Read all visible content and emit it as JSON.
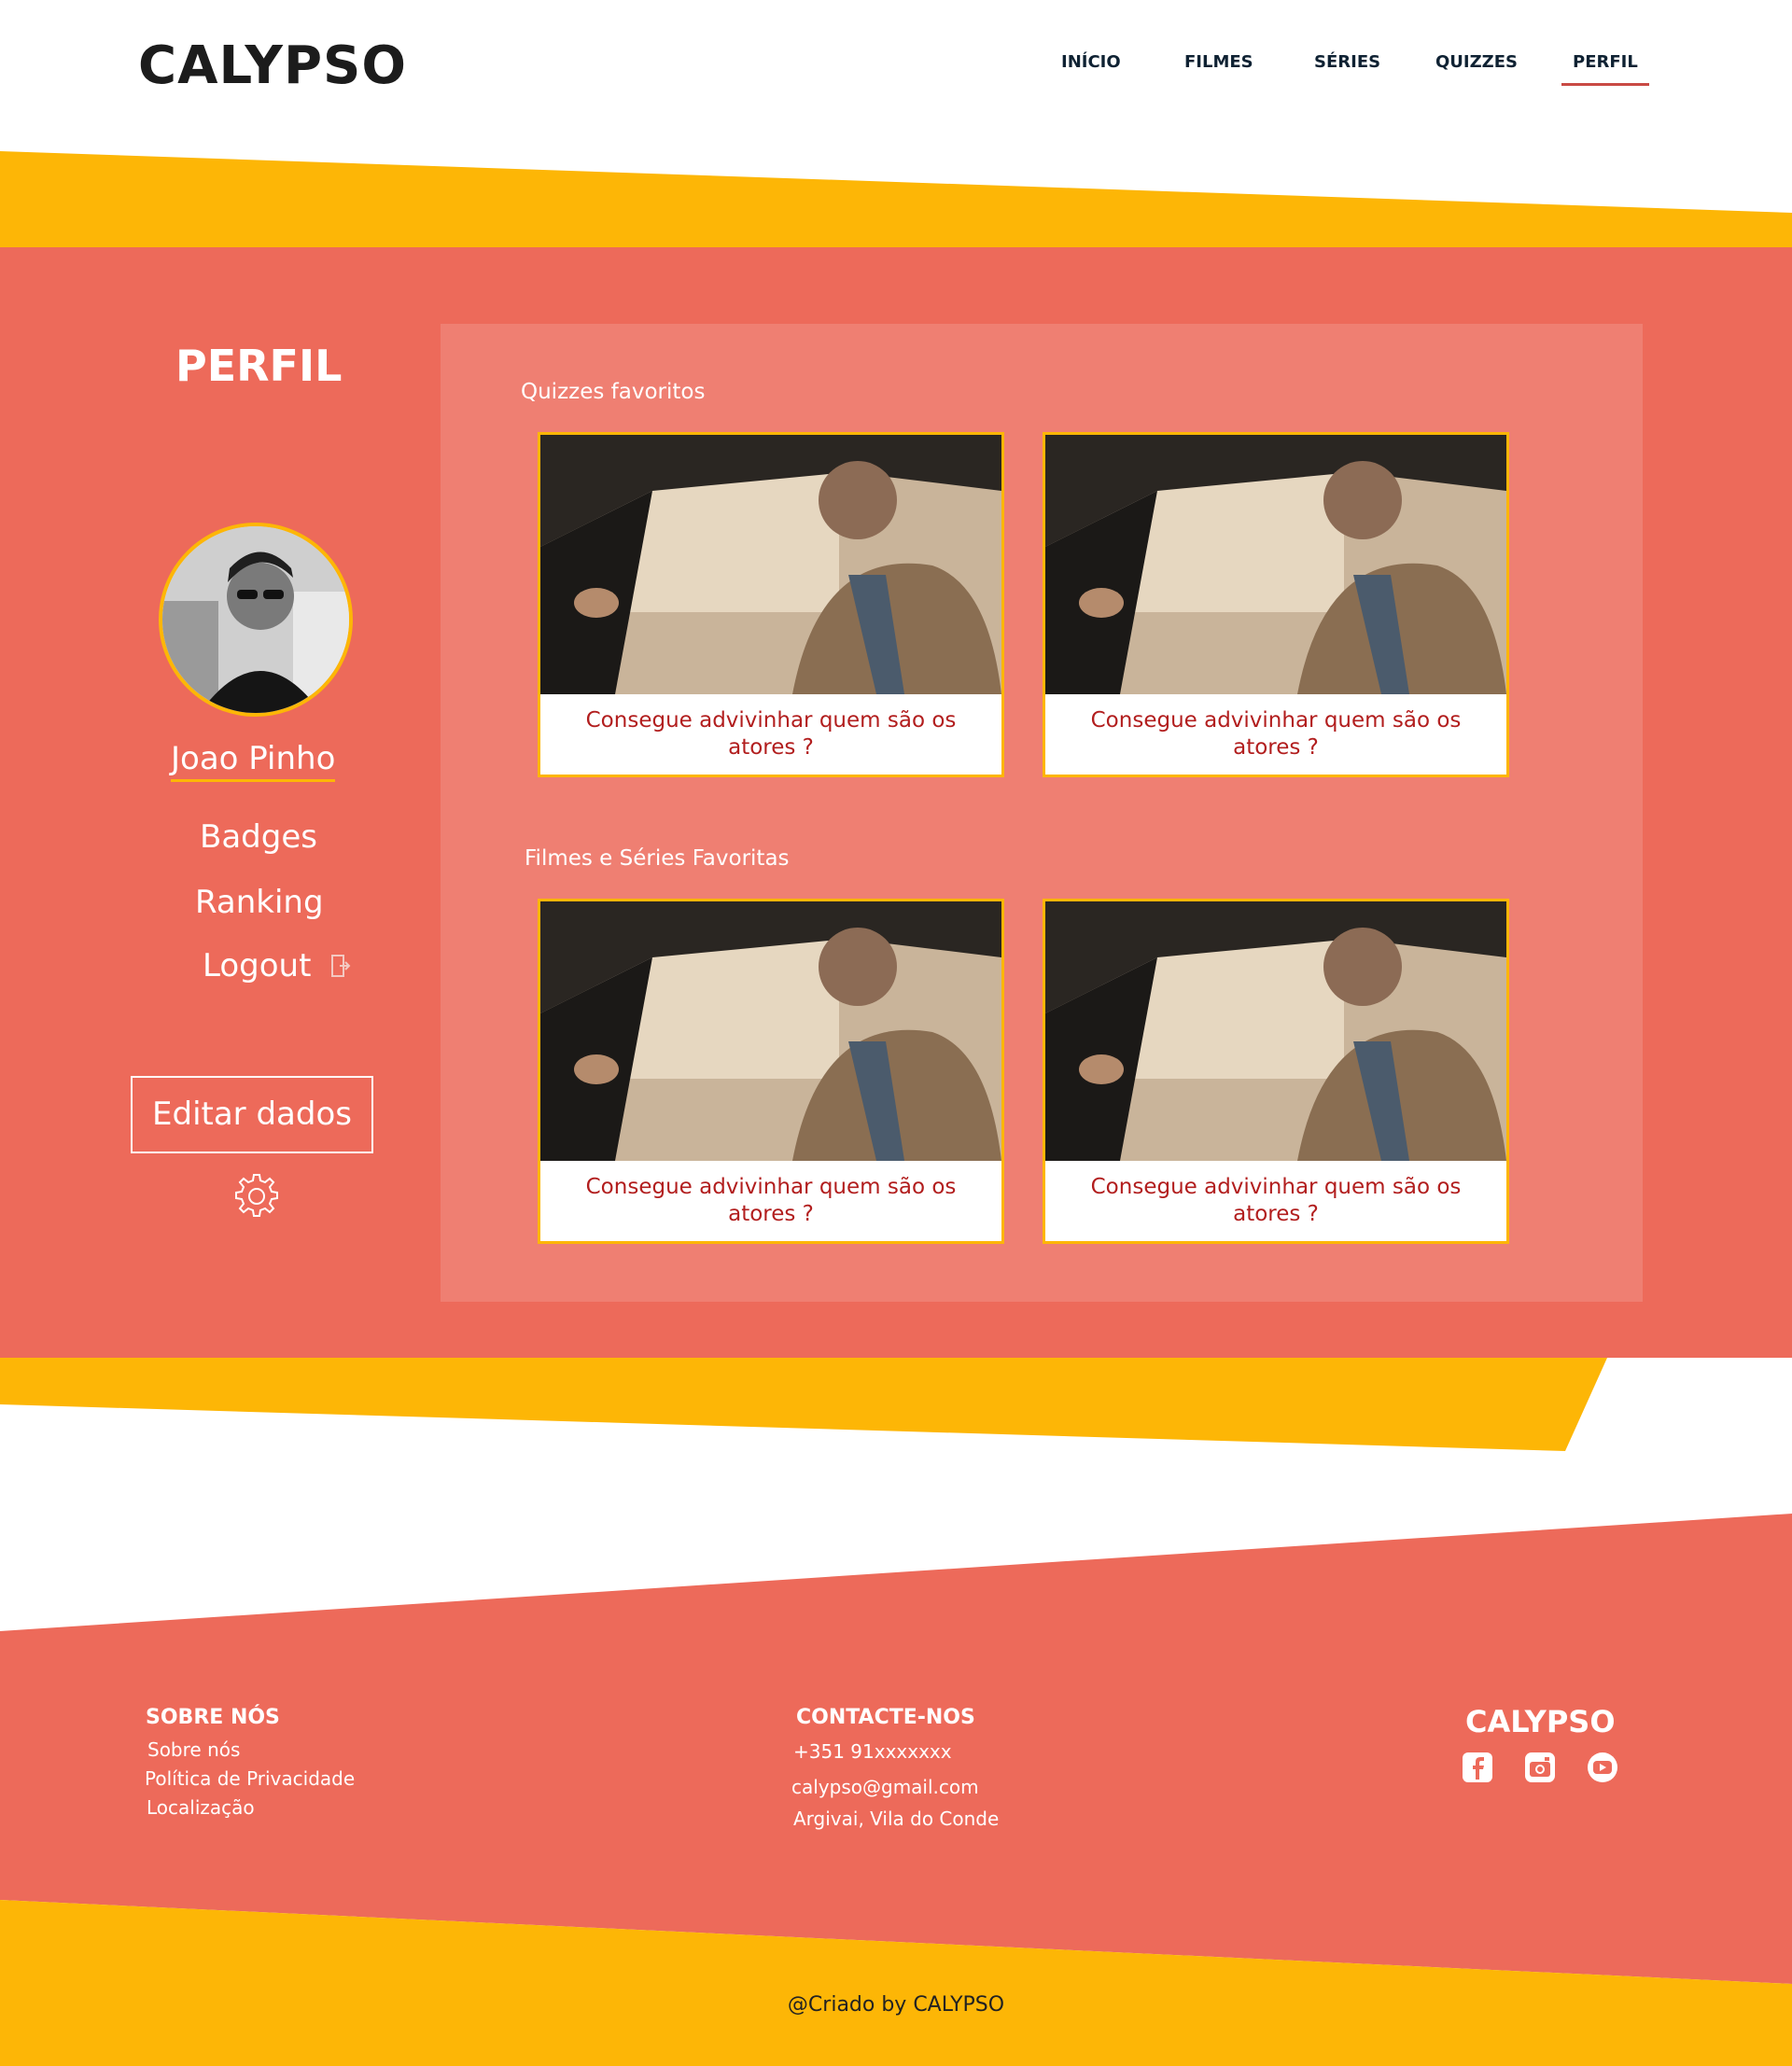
{
  "header": {
    "logo": "CALYPSO",
    "nav": [
      {
        "label": "INÍCIO"
      },
      {
        "label": "FILMES"
      },
      {
        "label": "SÉRIES"
      },
      {
        "label": "QUIZZES"
      },
      {
        "label": "PERFIL",
        "active": true
      }
    ]
  },
  "profile": {
    "title": "PERFIL",
    "username": "Joao Pinho",
    "menu": [
      "Badges",
      "Ranking",
      "Logout"
    ],
    "edit_button": "Editar dados"
  },
  "favorites": {
    "quizzes_label": "Quizzes favoritos",
    "media_label": "Filmes e Séries Favoritas",
    "quizzes": [
      {
        "caption": "Consegue advivinhar quem são os atores ?"
      },
      {
        "caption": "Consegue advivinhar quem são os atores ?"
      }
    ],
    "media": [
      {
        "caption": "Consegue advivinhar quem são os atores ?"
      },
      {
        "caption": "Consegue advivinhar quem são os atores ?"
      }
    ]
  },
  "footer": {
    "about": {
      "heading": "SOBRE NÓS",
      "items": [
        "Sobre nós",
        "Política de Privacidade",
        "Localização"
      ]
    },
    "contact": {
      "heading": "CONTACTE-NOS",
      "items": [
        "+351 91xxxxxxx",
        "calypso@gmail.com",
        "Argivai, Vila do Conde"
      ]
    },
    "brand": "CALYPSO",
    "social": [
      "facebook-icon",
      "instagram-icon",
      "youtube-icon"
    ],
    "copyright": "@Criado by CALYPSO"
  },
  "colors": {
    "coral": "#ed6a5a",
    "panel": "#ef7f72",
    "yellow": "#fdb606",
    "caption_red": "#b21e1e"
  }
}
